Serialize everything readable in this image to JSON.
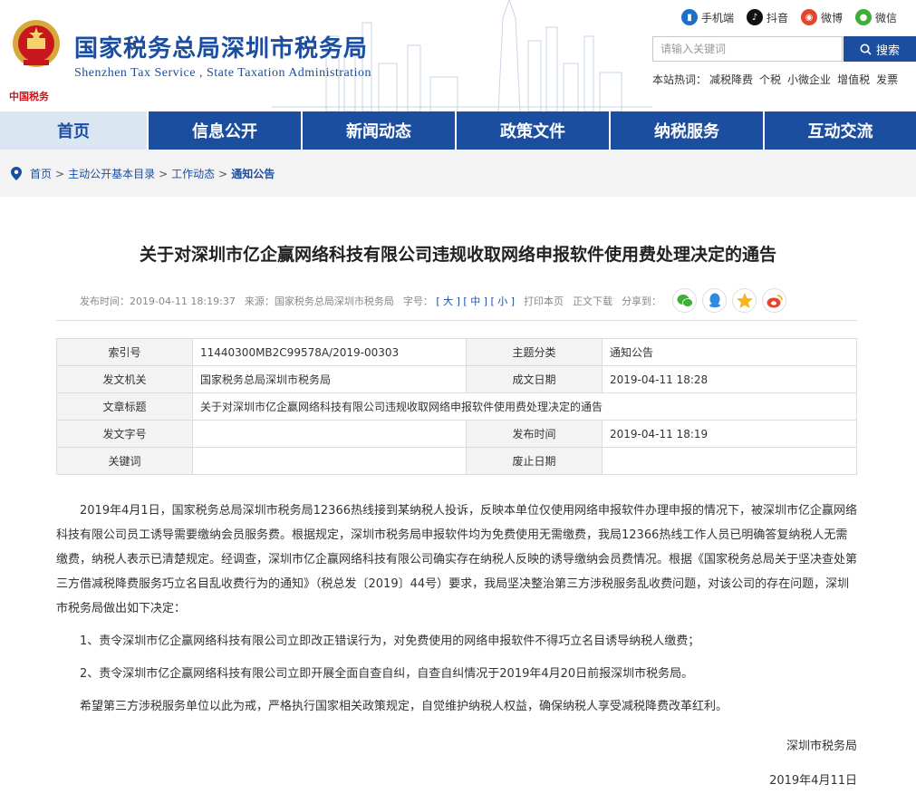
{
  "header": {
    "title": "国家税务总局深圳市税务局",
    "subtitle": "Shenzhen Tax Service , State Taxation Administration",
    "logo_caption": "中国税务",
    "social": [
      {
        "label": "手机端",
        "icon": "mobile-icon",
        "color": "#1c6fc7"
      },
      {
        "label": "抖音",
        "icon": "douyin-icon",
        "color": "#111111"
      },
      {
        "label": "微博",
        "icon": "weibo-icon",
        "color": "#e6442c"
      },
      {
        "label": "微信",
        "icon": "wechat-icon",
        "color": "#3cb034"
      }
    ],
    "search": {
      "placeholder": "请输入关键词",
      "button": "搜索"
    },
    "hotwords_label": "本站热词：",
    "hotwords": [
      "减税降费",
      "个税",
      "小微企业",
      "增值税",
      "发票"
    ]
  },
  "nav": [
    "首页",
    "信息公开",
    "新闻动态",
    "政策文件",
    "纳税服务",
    "互动交流"
  ],
  "breadcrumb": [
    "首页",
    "主动公开基本目录",
    "工作动态",
    "通知公告"
  ],
  "article": {
    "title": "关于对深圳市亿企赢网络科技有限公司违规收取网络申报软件使用费处理决定的通告",
    "meta": {
      "publish_time": "发布时间：2019-04-11 18:19:37",
      "source": "来源：国家税务总局深圳市税务局",
      "font_label": "字号：",
      "font_large": "[ 大 ]",
      "font_mid": "[ 中 ]",
      "font_small": "[ 小 ]",
      "print": "打印本页",
      "download": "正文下载",
      "share": "分享到："
    },
    "info": {
      "index_label": "索引号",
      "index_value": "11440300MB2C99578A/2019-00303",
      "topic_label": "主题分类",
      "topic_value": "通知公告",
      "issuer_label": "发文机关",
      "issuer_value": "国家税务总局深圳市税务局",
      "created_label": "成文日期",
      "created_value": "2019-04-11 18:28",
      "subject_label": "文章标题",
      "subject_value": "关于对深圳市亿企赢网络科技有限公司违规收取网络申报软件使用费处理决定的通告",
      "docno_label": "发文字号",
      "docno_value": "",
      "published_label": "发布时间",
      "published_value": "2019-04-11 18:19",
      "keywords_label": "关键词",
      "keywords_value": "",
      "abolished_label": "废止日期",
      "abolished_value": ""
    },
    "paragraphs": [
      "2019年4月1日，国家税务总局深圳市税务局12366热线接到某纳税人投诉，反映本单位仅使用网络申报软件办理申报的情况下，被深圳市亿企赢网络科技有限公司员工诱导需要缴纳会员服务费。根据规定，深圳市税务局申报软件均为免费使用无需缴费，我局12366热线工作人员已明确答复纳税人无需缴费，纳税人表示已清楚规定。经调查，深圳市亿企赢网络科技有限公司确实存在纳税人反映的诱导缴纳会员费情况。根据《国家税务总局关于坚决查处第三方借减税降费服务巧立名目乱收费行为的通知》（税总发〔2019〕44号）要求，我局坚决整治第三方涉税服务乱收费问题，对该公司的存在问题，深圳市税务局做出如下决定：",
      "1、责令深圳市亿企赢网络科技有限公司立即改正错误行为，对免费使用的网络申报软件不得巧立名目诱导纳税人缴费；",
      "2、责令深圳市亿企赢网络科技有限公司立即开展全面自查自纠，自查自纠情况于2019年4月20日前报深圳市税务局。",
      "希望第三方涉税服务单位以此为戒，严格执行国家相关政策规定，自觉维护纳税人权益，确保纳税人享受减税降费改革红利。"
    ],
    "signature": "深圳市税务局",
    "date": "2019年4月11日"
  }
}
